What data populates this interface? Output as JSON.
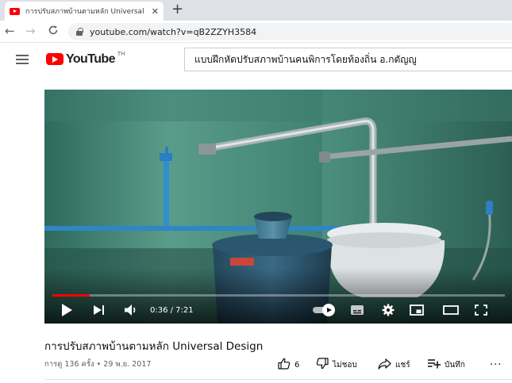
{
  "browser": {
    "tab_title": "การปรับสภาพบ้านตามหลัก Universal",
    "tab_close_glyph": "✕",
    "newtab_glyph": "+",
    "back_glyph": "←",
    "forward_glyph": "→",
    "reload_glyph": "C",
    "url": "youtube.com/watch?v=qB2ZZYH3584"
  },
  "youtube": {
    "logo_text": "YouTube",
    "logo_country": "TH",
    "search_value": "แบบฝึกหัดปรับสภาพบ้านคนพิการโดยท้องถิ่น อ.กตัญญู"
  },
  "player": {
    "time_display": "0:36 / 7:21",
    "progress_fraction": 0.082
  },
  "video": {
    "title": "การปรับสภาพบ้านตามหลัก Universal Design",
    "meta": "การดู 136 ครั้ง • 29 พ.ย. 2017",
    "like_count": "6",
    "dislike_label": "ไม่ชอบ",
    "share_label": "แชร์",
    "save_label": "บันทึก",
    "more_glyph": "···"
  },
  "icons": {
    "tab": "youtube-favicon-icon",
    "secure": "lock-icon",
    "menu": "hamburger-menu-icon",
    "play": "play-icon",
    "next": "next-icon",
    "volume": "volume-icon",
    "autoplay": "autoplay-toggle-icon",
    "subtitles": "subtitles-icon",
    "settings": "gear-icon",
    "miniplayer": "miniplayer-icon",
    "theater": "theater-mode-icon",
    "fullscreen": "fullscreen-icon",
    "like": "thumbs-up-icon",
    "dislike": "thumbs-down-icon",
    "share": "share-arrow-icon",
    "save": "add-to-playlist-icon",
    "more": "more-horizontal-icon"
  },
  "colors": {
    "brand_red": "#ff0000",
    "progress": "#ff0000",
    "chrome_bg": "#dee1e6",
    "wall_teal": "#3a7a6c"
  }
}
